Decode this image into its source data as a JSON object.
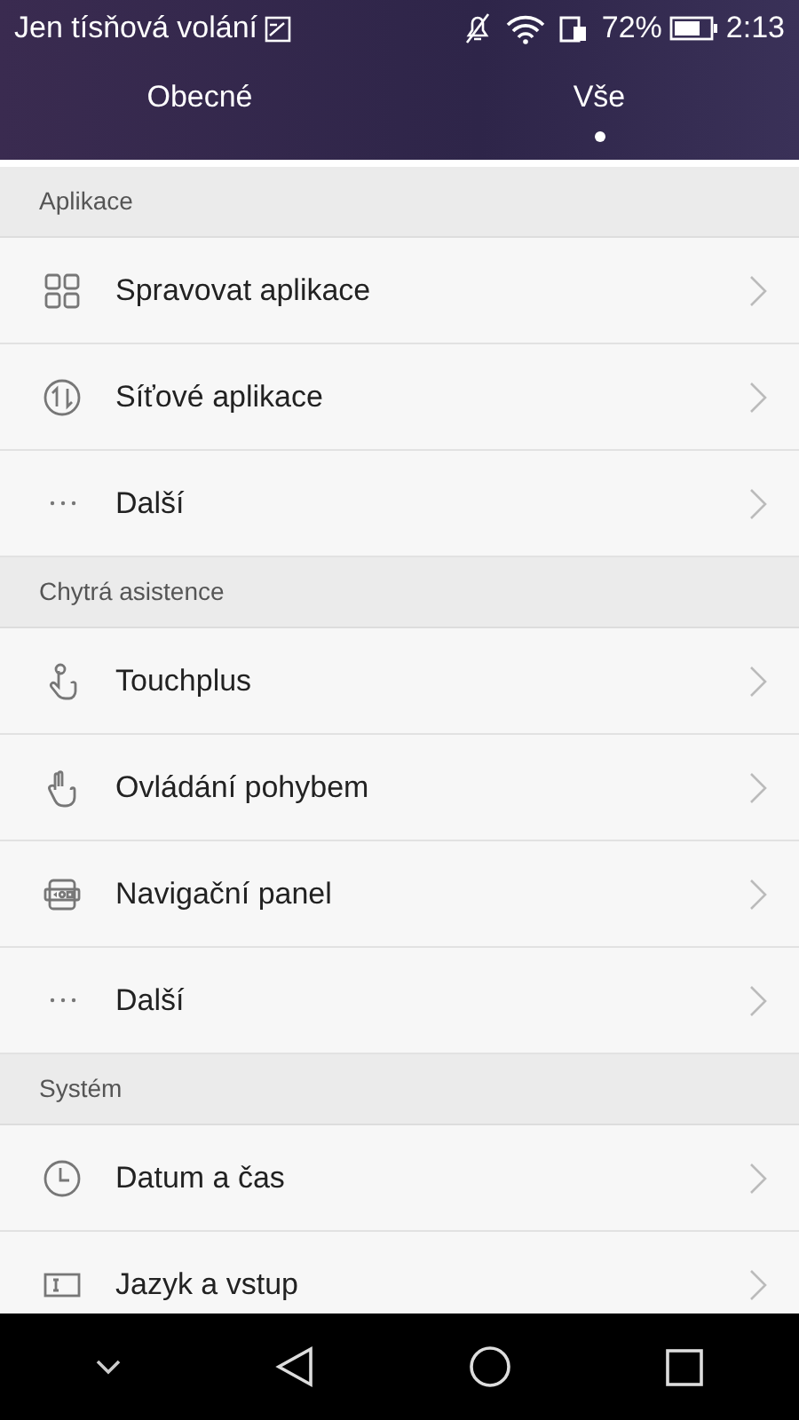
{
  "status_bar": {
    "carrier": "Jen tísňová volání",
    "battery": "72%",
    "time": "2:13"
  },
  "tabs": [
    {
      "label": "Obecné",
      "selected": false
    },
    {
      "label": "Vše",
      "selected": true
    }
  ],
  "sections": [
    {
      "title": "Aplikace",
      "items": [
        {
          "label": "Spravovat aplikace"
        },
        {
          "label": "Síťové aplikace"
        },
        {
          "label": "Další"
        }
      ]
    },
    {
      "title": "Chytrá asistence",
      "items": [
        {
          "label": "Touchplus"
        },
        {
          "label": "Ovládání pohybem"
        },
        {
          "label": "Navigační panel"
        },
        {
          "label": "Další"
        }
      ]
    },
    {
      "title": "Systém",
      "items": [
        {
          "label": "Datum a čas"
        },
        {
          "label": "Jazyk a vstup"
        }
      ]
    }
  ]
}
